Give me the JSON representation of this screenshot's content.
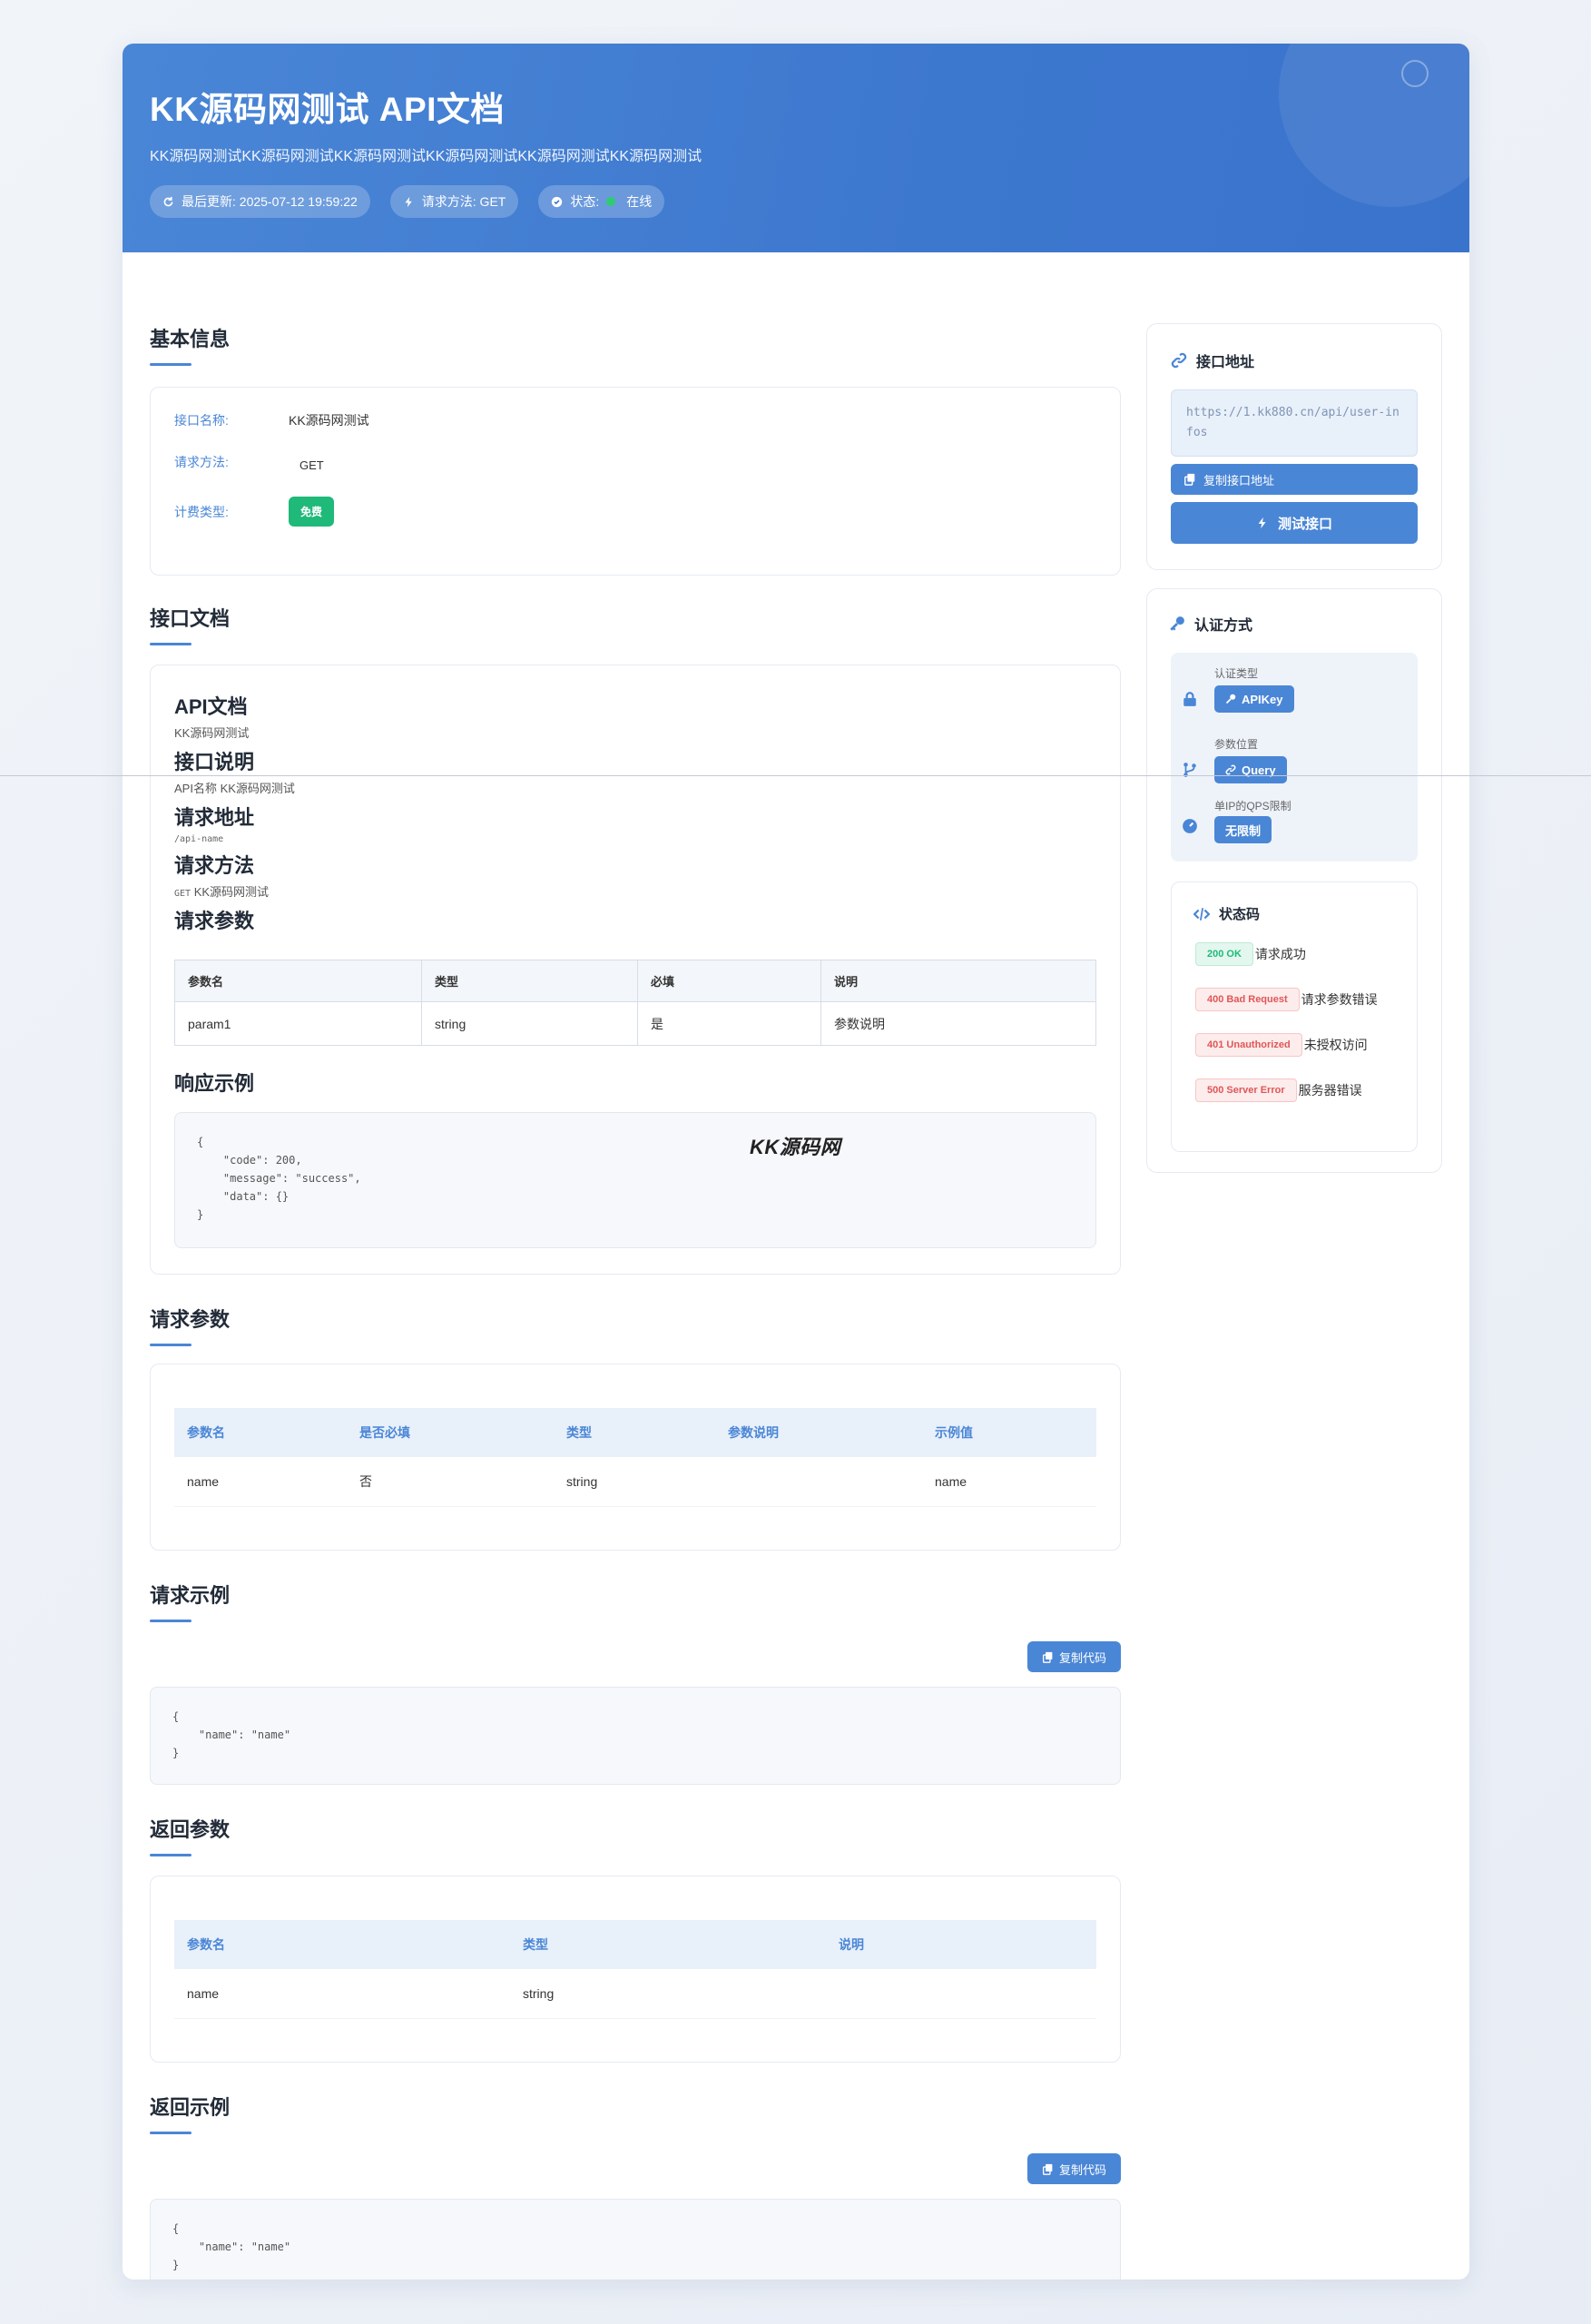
{
  "header": {
    "title": "KK源码网测试 API文档",
    "subtitle": "KK源码网测试KK源码网测试KK源码网测试KK源码网测试KK源码网测试KK源码网测试",
    "last_update": "最后更新: 2025-07-12 19:59:22",
    "method": "请求方法: GET",
    "status_label": "状态:",
    "status_value": "在线"
  },
  "basic_info": {
    "title": "基本信息",
    "name_label": "接口名称:",
    "name_value": "KK源码网测试",
    "method_label": "请求方法:",
    "method_value": "GET",
    "billing_label": "计费类型:",
    "billing_value": "免费"
  },
  "api_doc": {
    "title": "接口文档",
    "h_api": "API文档",
    "api_text": "KK源码网测试",
    "h_desc": "接口说明",
    "desc_text": "API名称 KK源码网测试",
    "h_url": "请求地址",
    "url_text": "/api-name",
    "h_method": "请求方法",
    "method_code": "GET",
    "method_text": "KK源码网测试",
    "h_params": "请求参数",
    "param_headers": [
      "参数名",
      "类型",
      "必填",
      "说明"
    ],
    "param_rows": [
      [
        "param1",
        "string",
        "是",
        "参数说明"
      ]
    ],
    "h_response": "响应示例",
    "response_code": "{\n    \"code\": 200,\n    \"message\": \"success\",\n    \"data\": {}\n}"
  },
  "request_params": {
    "title": "请求参数",
    "headers": [
      "参数名",
      "是否必填",
      "类型",
      "参数说明",
      "示例值"
    ],
    "rows": [
      [
        "name",
        "否",
        "string",
        "",
        "name"
      ]
    ]
  },
  "request_example": {
    "title": "请求示例",
    "copy_label": "复制代码",
    "code": "{\n    \"name\": \"name\"\n}"
  },
  "response_params": {
    "title": "返回参数",
    "headers": [
      "参数名",
      "类型",
      "说明"
    ],
    "rows": [
      [
        "name",
        "string",
        ""
      ]
    ]
  },
  "response_example": {
    "title": "返回示例",
    "copy_label": "复制代码",
    "code": "{\n    \"name\": \"name\"\n}"
  },
  "sidebar": {
    "endpoint": {
      "title": "接口地址",
      "url": "https://1.kk880.cn/api/user-infos",
      "copy_label": "复制接口地址",
      "test_label": "测试接口"
    },
    "auth": {
      "title": "认证方式",
      "type_label": "认证类型",
      "type_value": "APIKey",
      "location_label": "参数位置",
      "location_value": "Query",
      "qps_label": "单IP的QPS限制",
      "qps_value": "无限制"
    },
    "status_codes": {
      "title": "状态码",
      "items": [
        {
          "tag": "200 OK",
          "desc": "请求成功"
        },
        {
          "tag": "400 Bad Request",
          "desc": "请求参数错误"
        },
        {
          "tag": "401 Unauthorized",
          "desc": "未授权访问"
        },
        {
          "tag": "500 Server Error",
          "desc": "服务器错误"
        }
      ]
    }
  },
  "watermark": "KK源码网",
  "colors": {
    "primary": "#4a86d6",
    "success": "#1fb97a",
    "error": "#e05656"
  }
}
